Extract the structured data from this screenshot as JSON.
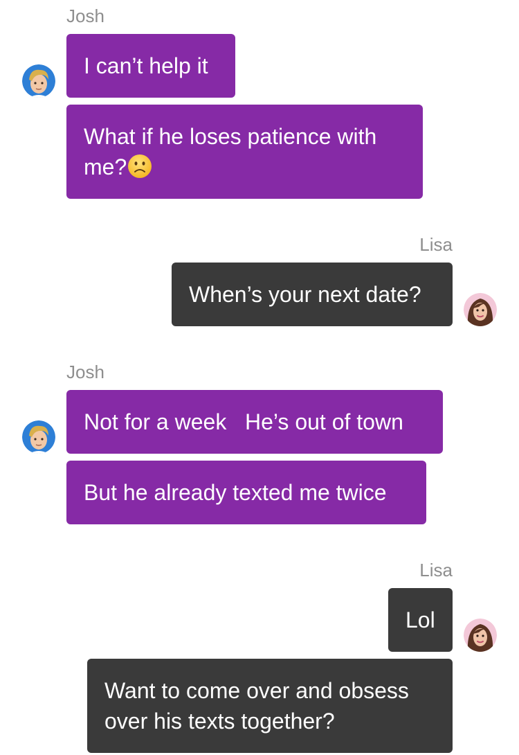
{
  "conversation": {
    "blocks": [
      {
        "sender": "Josh",
        "messages": [
          {
            "text": "I can’t help it",
            "emoji": ""
          },
          {
            "text": "What if he loses patience with me?",
            "emoji": "slightly-frowning-face"
          }
        ]
      },
      {
        "sender": "Lisa",
        "messages": [
          {
            "text": "When’s your next date?",
            "emoji": ""
          }
        ]
      },
      {
        "sender": "Josh",
        "messages": [
          {
            "text": "Not for a week   He’s out of town",
            "emoji": ""
          },
          {
            "text": "But he already texted me twice",
            "emoji": ""
          }
        ]
      },
      {
        "sender": "Lisa",
        "messages": [
          {
            "text": "Lol",
            "emoji": ""
          },
          {
            "text": "Want to come over and obsess over his texts together?",
            "emoji": ""
          }
        ]
      }
    ]
  },
  "colors": {
    "josh_bubble": "#862aa6",
    "lisa_bubble": "#3a3a3a",
    "sender_name": "#8e8e8e",
    "bubble_text": "#ffffff"
  },
  "avatars": {
    "josh": "avatar-josh-blond-man",
    "lisa": "avatar-lisa-brunette-woman"
  }
}
